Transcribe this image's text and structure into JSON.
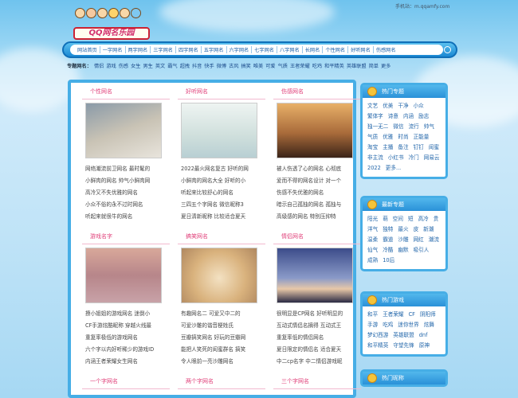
{
  "header": {
    "mobile": "手机站：m.qqamfy.com",
    "logo": "QQ网名乐园"
  },
  "nav": [
    "网站首页",
    "一字网名",
    "两字网名",
    "三字网名",
    "四字网名",
    "五字网名",
    "六字网名",
    "七字网名",
    "八字网名",
    "长网名",
    "个性网名",
    "好听网名",
    "伤感网名"
  ],
  "topic_bar": {
    "label": "专题网名：",
    "items": [
      "情侣",
      "游戏",
      "伤感",
      "女生",
      "男生",
      "英文",
      "霸气",
      "超拽",
      "抖音",
      "快手",
      "微博",
      "古风",
      "搞笑",
      "唯美",
      "可爱",
      "气质",
      "王者荣耀",
      "吃鸡",
      "和平精英",
      "英雄联盟",
      "简单",
      "更多"
    ]
  },
  "sections": [
    {
      "title": "个性网名",
      "lines": [
        "网络潮流前卫网名 最时髦的",
        "小鲜肉的网名 帅气小鲜肉网",
        "高冷又不失优雅的网名",
        "小众不俗的永不过时网名",
        "听起来就很牛的网名"
      ]
    },
    {
      "title": "好听网名",
      "lines": [
        "2022最火网名复古 好听的网",
        "小鲜肉的网名大全 好听的小",
        "听起来比较舒心的网名",
        "三四五个字网名 微信昵称3",
        "夏日清新昵称 比较适合夏天"
      ]
    },
    {
      "title": "伤感网名",
      "lines": [
        "被人伤透了心的网名 心彻底",
        "爱而不得的网名设计 对一个",
        "伤感不失优雅的网名",
        "暗示自己孤独的网名 孤独与",
        "高级感的网名 特别压抑特"
      ]
    },
    {
      "title": "游戏名字",
      "lines": [
        "撩小姐姐的游戏网名 迷倒小",
        "CF手游炫酷昵称 穿越火线最",
        "重复率极低的游戏网名",
        "六个字以内好听稀少的游戏ID",
        "内涵王者荣耀女生网名"
      ]
    },
    {
      "title": "搞笑网名",
      "lines": [
        "有趣网名二 可爱又中二的",
        "可爱沙雕的谐音梗姓氏",
        "豆瓣搞笑网名 好玩的豆瓣网",
        "能把人笑死的闺蜜群名 搞笑",
        "令人眼前一亮沙雕网名"
      ]
    },
    {
      "title": "情侣网名",
      "lines": [
        "很明显是CP网名 好听明显的",
        "互动式情侣名摘得 互动式王",
        "重复率低的情侣网名",
        "夏日限定的情侣名 适合夏天",
        "中二cp名字 中二情侣游戏昵"
      ]
    },
    {
      "title": "一个字网名",
      "lines": []
    },
    {
      "title": "两个字网名",
      "lines": []
    },
    {
      "title": "三个字网名",
      "lines": []
    }
  ],
  "sidebar": [
    {
      "title": "热门专题",
      "tags": [
        "文艺",
        "优美",
        "干净",
        "小众",
        "繁体字",
        "诗意",
        "内涵",
        "励志",
        "独一无二",
        "微信",
        "流行",
        "帅气",
        "气质",
        "优雅",
        "时尚",
        "正能量",
        "淘宝",
        "主播",
        "备注",
        "钉钉",
        "闺蜜",
        "非主流",
        "小红书",
        "冷门",
        "网易云",
        "2022",
        "更多..."
      ]
    },
    {
      "title": "最新专题",
      "tags": [
        "阳光",
        "萌",
        "空间",
        "短",
        "高冷",
        "贵",
        "洋气",
        "独特",
        "最火",
        "皮",
        "新潮",
        "温柔",
        "霸道",
        "沙雕",
        "网红",
        "潮流",
        "仙气",
        "冷酷",
        "幽默",
        "吸引人",
        "成熟",
        "10后"
      ]
    },
    {
      "title": "热门游戏",
      "tags": [
        "和平",
        "王者荣耀",
        "CF",
        "阴阳师",
        "手游",
        "吃鸡",
        "迷你世界",
        "炫舞",
        "梦幻西游",
        "英雄联盟",
        "dnf",
        "和平精英",
        "守望先锋",
        "原神"
      ]
    },
    {
      "title": "热门昵称",
      "tags": []
    }
  ]
}
